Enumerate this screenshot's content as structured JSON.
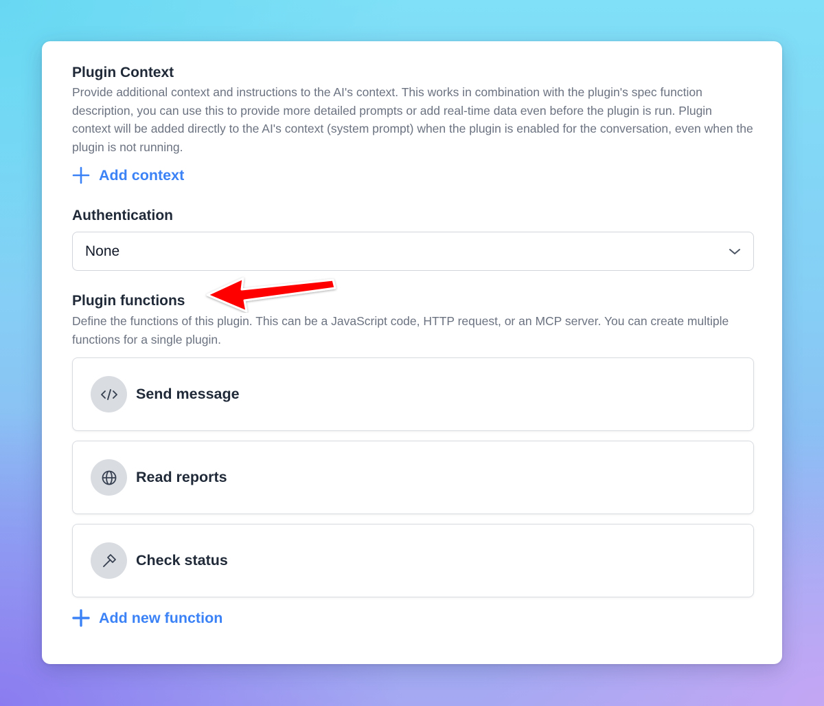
{
  "plugin_context": {
    "title": "Plugin Context",
    "description": "Provide additional context and instructions to the AI's context. This works in combination with the plugin's spec function description, you can use this to provide more detailed prompts or add real-time data even before the plugin is run. Plugin context will be added directly to the AI's context (system prompt) when the plugin is enabled for the conversation, even when the plugin is not running.",
    "add_label": "Add context"
  },
  "authentication": {
    "title": "Authentication",
    "selected": "None"
  },
  "plugin_functions": {
    "title": "Plugin functions",
    "description": "Define the functions of this plugin. This can be a JavaScript code, HTTP request, or an MCP server. You can create multiple functions for a single plugin.",
    "items": [
      {
        "label": "Send message",
        "icon": "code-icon"
      },
      {
        "label": "Read reports",
        "icon": "globe-icon"
      },
      {
        "label": "Check status",
        "icon": "hammer-icon"
      }
    ],
    "add_label": "Add new function"
  },
  "colors": {
    "accent": "#3b82f6",
    "annotation_arrow": "#ff0000"
  }
}
